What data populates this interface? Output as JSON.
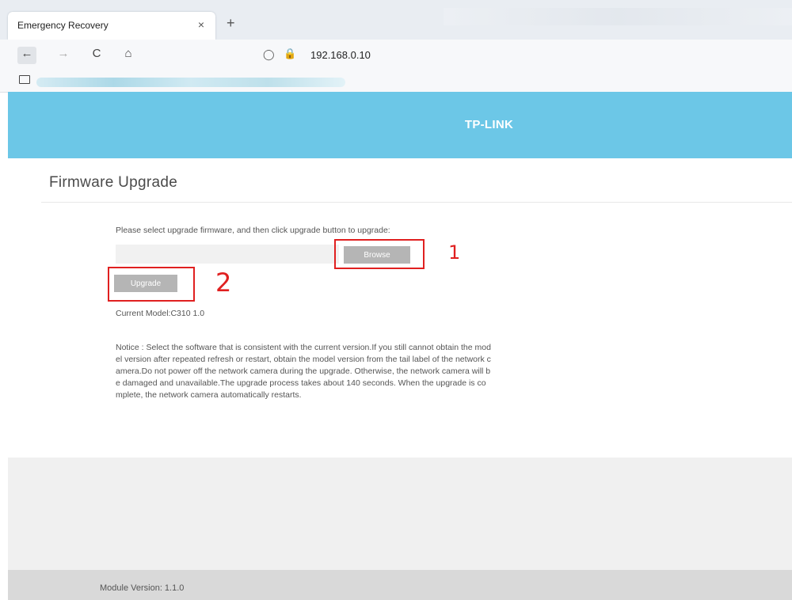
{
  "browser": {
    "tab_title": "Emergency Recovery",
    "tab_close": "×",
    "new_tab": "+",
    "back": "←",
    "forward": "→",
    "reload": "C",
    "home": "⌂",
    "shield": "◯",
    "lock": "🔒",
    "url": "192.168.0.10",
    "icons": [
      "close-icon",
      "plus-icon",
      "back-arrow-icon",
      "forward-arrow-icon",
      "reload-icon",
      "home-icon",
      "shield-icon",
      "lock-icon",
      "folder-icon"
    ]
  },
  "header": {
    "brand": "TP-LINK",
    "brand_bar_color": "#6cc7e7"
  },
  "main": {
    "title": "Firmware Upgrade",
    "instruction": "Please select upgrade firmware, and then click upgrade button to upgrade:",
    "file_input_value": "",
    "browse_label": "Browse",
    "upgrade_label": "Upgrade",
    "current_model": "Current Model:C310 1.0",
    "notice": "Notice : Select the software that is consistent with the current version.If you still cannot obtain the model version after repeated refresh or restart, obtain the model version from the tail label of the network camera.Do not power off the network camera during the upgrade. Otherwise, the network camera will be damaged and unavailable.The upgrade process takes about 140 seconds. When the upgrade is complete, the network camera automatically restarts."
  },
  "annotations": {
    "browse_marker": "1",
    "upgrade_marker": "2",
    "marker_color": "#e02020"
  },
  "footer": {
    "module_version": "Module Version: 1.1.0"
  }
}
